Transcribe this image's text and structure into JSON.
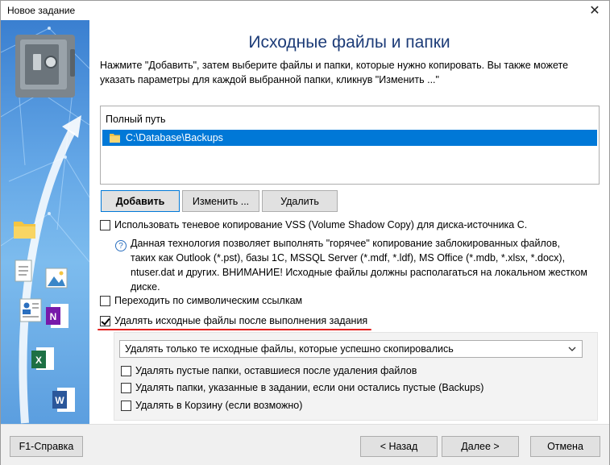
{
  "window": {
    "title": "Новое задание",
    "close_glyph": "✕"
  },
  "page": {
    "title": "Исходные файлы и папки",
    "description": "Нажмите \"Добавить\", затем выберите файлы и папки, которые нужно копировать. Вы также можете указать параметры для каждой выбранной папки, кликнув \"Изменить ...\""
  },
  "file_list": {
    "column_header": "Полный путь",
    "rows": [
      {
        "path": "C:\\Database\\Backups",
        "icon": "folder-icon",
        "selected": true
      }
    ]
  },
  "list_buttons": {
    "add": "Добавить",
    "edit": "Изменить ...",
    "delete": "Удалить"
  },
  "options": {
    "vss": {
      "label": "Использовать теневое копирование VSS (Volume Shadow Copy) для диска-источника C.",
      "checked": false
    },
    "vss_info": {
      "icon": "question-icon",
      "line1": "Данная технология позволяет выполнять \"горячее\" копирование заблокированных файлов,",
      "line2": "таких как Outlook (*.pst), базы 1С, MSSQL Server (*.mdf, *.ldf), MS Office (*.mdb, *.xlsx, *.docx),",
      "line3": "ntuser.dat и других. ВНИМАНИЕ! Исходные файлы должны располагаться на локальном жестком",
      "line4": "диске."
    },
    "follow_symlinks": {
      "label": "Переходить по символическим ссылкам",
      "checked": false
    },
    "delete_sources": {
      "label": "Удалять исходные файлы после выполнения задания",
      "checked": true
    }
  },
  "delete_panel": {
    "mode_select": {
      "value": "Удалять только те исходные файлы, которые успешно скопировались"
    },
    "delete_empty_folders": {
      "label": "Удалять пустые папки, оставшиеся после удаления файлов",
      "checked": false
    },
    "delete_task_folders": {
      "label": "Удалять папки, указанные в задании, если они остались пустые (Backups)",
      "checked": false
    },
    "to_recycle_bin": {
      "label": "Удалять в Корзину (если возможно)",
      "checked": false
    }
  },
  "footer": {
    "help": "F1-Справка",
    "back": "< Назад",
    "next": "Далее >",
    "cancel": "Отмена"
  },
  "colors": {
    "accent": "#0078d7",
    "title_text": "#1d3c78",
    "highlight_underline": "#e3211f"
  }
}
